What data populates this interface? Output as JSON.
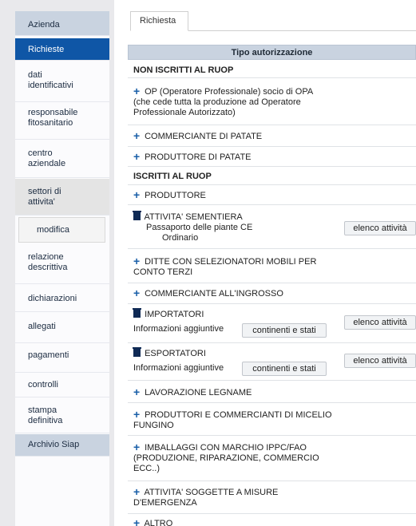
{
  "sidebar": {
    "azienda": "Azienda",
    "richieste": "Richieste",
    "dati": [
      "dati",
      "identificativi"
    ],
    "responsabile": [
      "responsabile",
      "fitosanitario"
    ],
    "centro": [
      "centro",
      "aziendale"
    ],
    "settori": [
      "settori di",
      "attivita'"
    ],
    "modifica": "modifica",
    "relazione": [
      "relazione",
      "descrittiva"
    ],
    "dichiarazioni": "dichiarazioni",
    "allegati": "allegati",
    "pagamenti": "pagamenti",
    "controlli": "controlli",
    "stampa": [
      "stampa",
      "definitiva"
    ],
    "archivio": "Archivio Siap"
  },
  "tab": "Richiesta",
  "table": {
    "header": "Tipo autorizzazione",
    "non_iscritti": "NON ISCRITTI AL RUOP",
    "op": [
      "OP (Operatore Professionale) socio di OPA",
      "(che cede tutta la produzione ad Operatore",
      "Professionale Autorizzato)"
    ],
    "commerciante_patate": "COMMERCIANTE DI PATATE",
    "produttore_patate": "PRODUTTORE DI PATATE",
    "iscritti": "ISCRITTI AL RUOP",
    "produttore": "PRODUTTORE",
    "sementiera": "ATTIVITA' SEMENTIERA",
    "sementiera_sub1": "Passaporto delle piante CE",
    "sementiera_sub2": "Ordinario",
    "ditte": [
      "DITTE CON SELEZIONATORI MOBILI PER",
      "CONTO TERZI"
    ],
    "ingrosso": "COMMERCIANTE ALL'INGROSSO",
    "importatori": "IMPORTATORI",
    "esportatori": "ESPORTATORI",
    "info_aggiuntive": "Informazioni aggiuntive",
    "legname": "LAVORAZIONE LEGNAME",
    "micelio": [
      "PRODUTTORI E COMMERCIANTI DI MICELIO",
      "FUNGINO"
    ],
    "imballaggi": [
      "IMBALLAGGI CON MARCHIO IPPC/FAO",
      "(PRODUZIONE, RIPARAZIONE, COMMERCIO",
      "ECC..)"
    ],
    "emergenza": [
      "ATTIVITA' SOGGETTE A MISURE",
      "D'EMERGENZA"
    ],
    "altro": "ALTRO"
  },
  "buttons": {
    "elenco_attivita": "elenco attività",
    "continenti_stati": "continenti e stati"
  },
  "icons": {
    "add": "plus-icon",
    "delete": "trash-icon"
  },
  "colors": {
    "accent": "#0f56a6",
    "header_bg": "#c9d3e0",
    "icon": "#1a5fa8"
  }
}
